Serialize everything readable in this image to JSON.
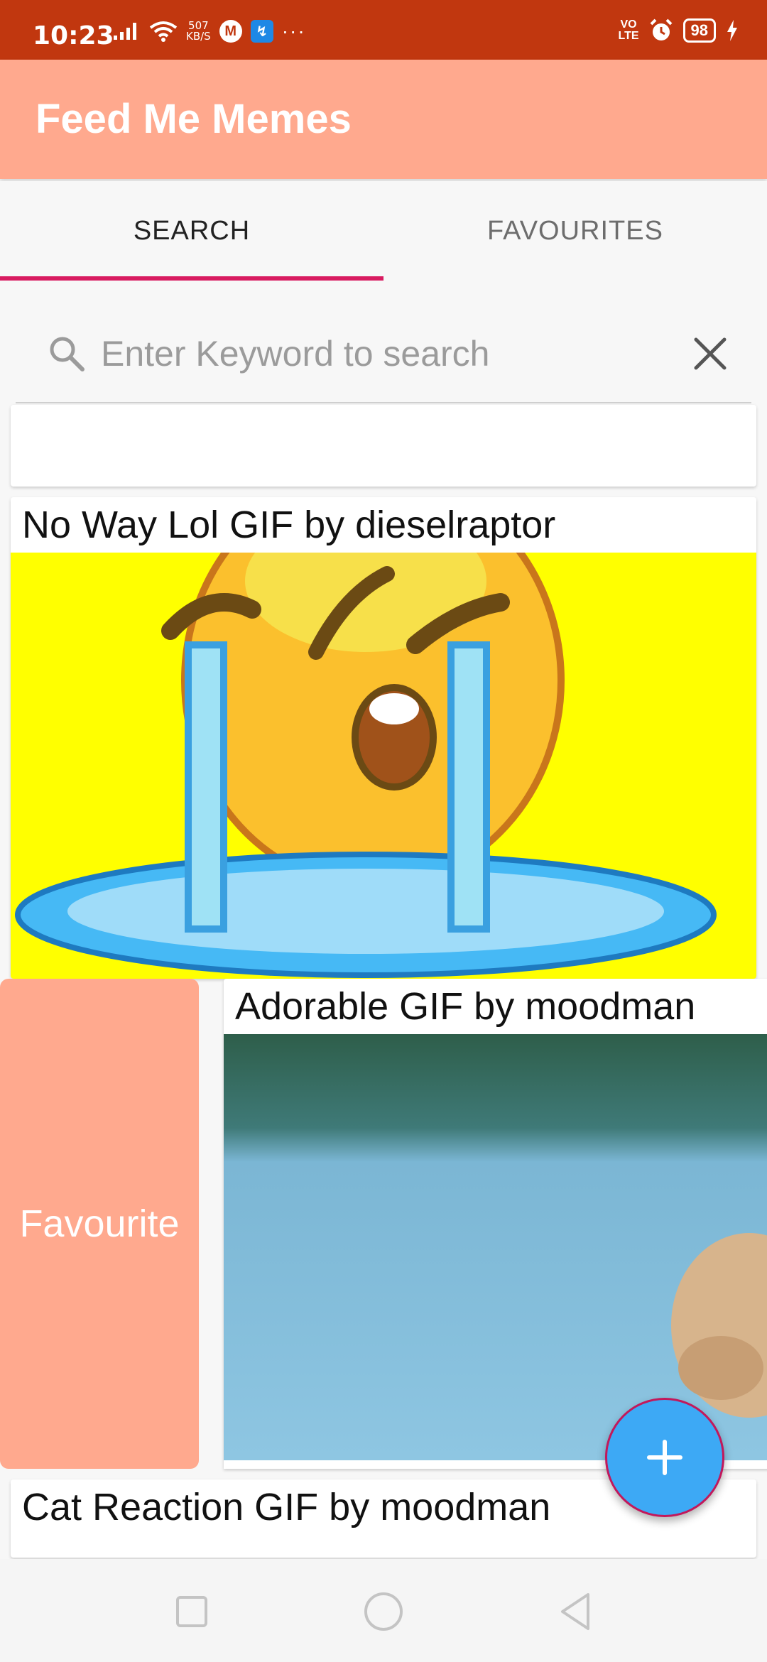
{
  "status_bar": {
    "time": "10:23",
    "speed_value": "507",
    "speed_unit": "KB/S",
    "mail_badge": "M",
    "usb_badge": "↯",
    "more": "···",
    "volte_top": "VO",
    "volte_bottom": "LTE",
    "battery": "98"
  },
  "app": {
    "title": "Feed Me Memes"
  },
  "tabs": [
    {
      "label": "SEARCH",
      "selected": true
    },
    {
      "label": "FAVOURITES",
      "selected": false
    }
  ],
  "search": {
    "placeholder": "Enter Keyword to search",
    "value": ""
  },
  "feed": [
    {
      "title": "No Way Lol GIF by dieselraptor"
    },
    {
      "title": "Adorable GIF by moodman",
      "swipe_action": "Favourite"
    },
    {
      "title": "Cat Reaction GIF by moodman"
    }
  ],
  "fab": {
    "label": "+"
  },
  "colors": {
    "status_bar": "#c1370f",
    "app_bar": "#ffa98e",
    "tab_indicator": "#d81b60",
    "fab": "#3da9f5"
  },
  "icons": [
    "search-icon",
    "close-icon",
    "plus-icon",
    "wifi-icon",
    "signal-icon",
    "alarm-icon",
    "battery-icon",
    "square-nav-icon",
    "circle-nav-icon",
    "back-nav-icon"
  ]
}
